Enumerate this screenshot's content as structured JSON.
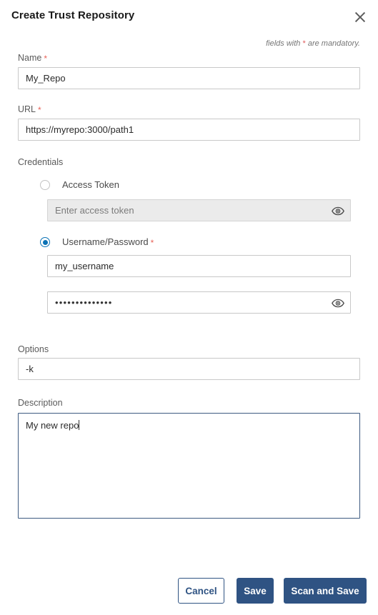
{
  "dialog": {
    "title": "Create Trust Repository",
    "close_icon": "close-icon",
    "mandatory_note_before": "fields with ",
    "mandatory_note_star": "*",
    "mandatory_note_after": " are mandatory."
  },
  "form": {
    "name": {
      "label": "Name",
      "required": true,
      "value": "My_Repo",
      "placeholder": ""
    },
    "url": {
      "label": "URL",
      "required": true,
      "value": "https://myrepo:3000/path1",
      "placeholder": ""
    },
    "credentials": {
      "label": "Credentials",
      "selected": "username_password",
      "access_token": {
        "radio_label": "Access Token",
        "selected": false,
        "value": "",
        "placeholder": "Enter access token",
        "disabled": true,
        "reveal_icon": "eye-icon"
      },
      "username_password": {
        "radio_label": "Username/Password",
        "required": true,
        "selected": true,
        "username": {
          "value": "my_username",
          "placeholder": ""
        },
        "password": {
          "value": "••••••••••••••",
          "placeholder": "",
          "masked": true,
          "reveal_icon": "eye-icon"
        }
      }
    },
    "options": {
      "label": "Options",
      "value": "-k",
      "placeholder": ""
    },
    "description": {
      "label": "Description",
      "value": "My new repo",
      "placeholder": "",
      "focused": true
    }
  },
  "footer": {
    "cancel_label": "Cancel",
    "save_label": "Save",
    "scan_and_save_label": "Scan and Save"
  },
  "colors": {
    "primary": "#2f5383",
    "radio_selected": "#0b72b5",
    "required_star": "#e8645a",
    "focus_border": "#3d5a80"
  }
}
